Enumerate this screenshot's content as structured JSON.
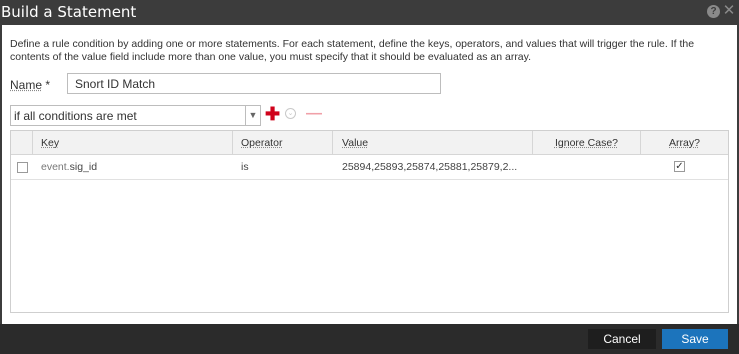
{
  "dialog": {
    "title": "Build a Statement",
    "help_glyph": "?",
    "close_glyph": "✕",
    "description": "Define a rule condition by adding one or more statements. For each statement, define the keys, operators, and values that will trigger the rule. If the contents of the value field include more than one value, you must specify that it should be evaluated as an array."
  },
  "name": {
    "label": "Name",
    "required_mark": "*",
    "value": "Snort ID Match"
  },
  "condition": {
    "selected": "if all conditions are met",
    "add_glyph": "✚",
    "move_down_glyph": "⌄",
    "remove_glyph": "—"
  },
  "grid": {
    "columns": [
      "Key",
      "Operator",
      "Value",
      "Ignore Case?",
      "Array?"
    ],
    "rows": [
      {
        "selected": false,
        "key_prefix": "event.",
        "key_name": "sig_id",
        "operator": "is",
        "value": "25894,25893,25874,25881,25879,2...",
        "ignore_case": "",
        "array": true,
        "array_glyph": "✓"
      }
    ]
  },
  "footer": {
    "cancel_label": "Cancel",
    "save_label": "Save"
  }
}
